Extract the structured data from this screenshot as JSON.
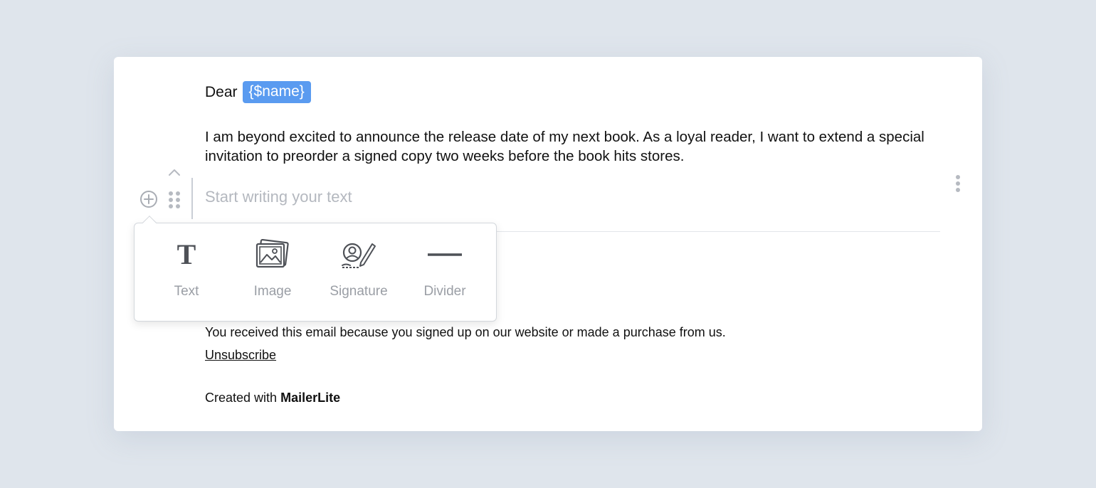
{
  "email": {
    "greeting": "Dear",
    "name_tag": "{$name}",
    "body": "I am beyond excited to announce the release date of my next book. As a loyal reader, I want to extend a special invitation to preorder a signed copy two weeks before the book hits stores."
  },
  "editor": {
    "placeholder": "Start writing your text",
    "icons": {
      "add": "add-block-icon",
      "drag": "drag-handle-icon",
      "move_up": "chevron-up-icon",
      "more": "more-vertical-icon"
    }
  },
  "block_menu": {
    "items": [
      {
        "label": "Text",
        "icon": "text-icon"
      },
      {
        "label": "Image",
        "icon": "image-icon"
      },
      {
        "label": "Signature",
        "icon": "signature-icon"
      },
      {
        "label": "Divider",
        "icon": "divider-icon"
      }
    ]
  },
  "footer": {
    "notice": "You received this email because you signed up on our website or made a purchase from us.",
    "unsubscribe": "Unsubscribe",
    "created_prefix": "Created with",
    "brand": "MailerLite"
  },
  "colors": {
    "background": "#dfe5ec",
    "tag": "#5a9bf0"
  }
}
